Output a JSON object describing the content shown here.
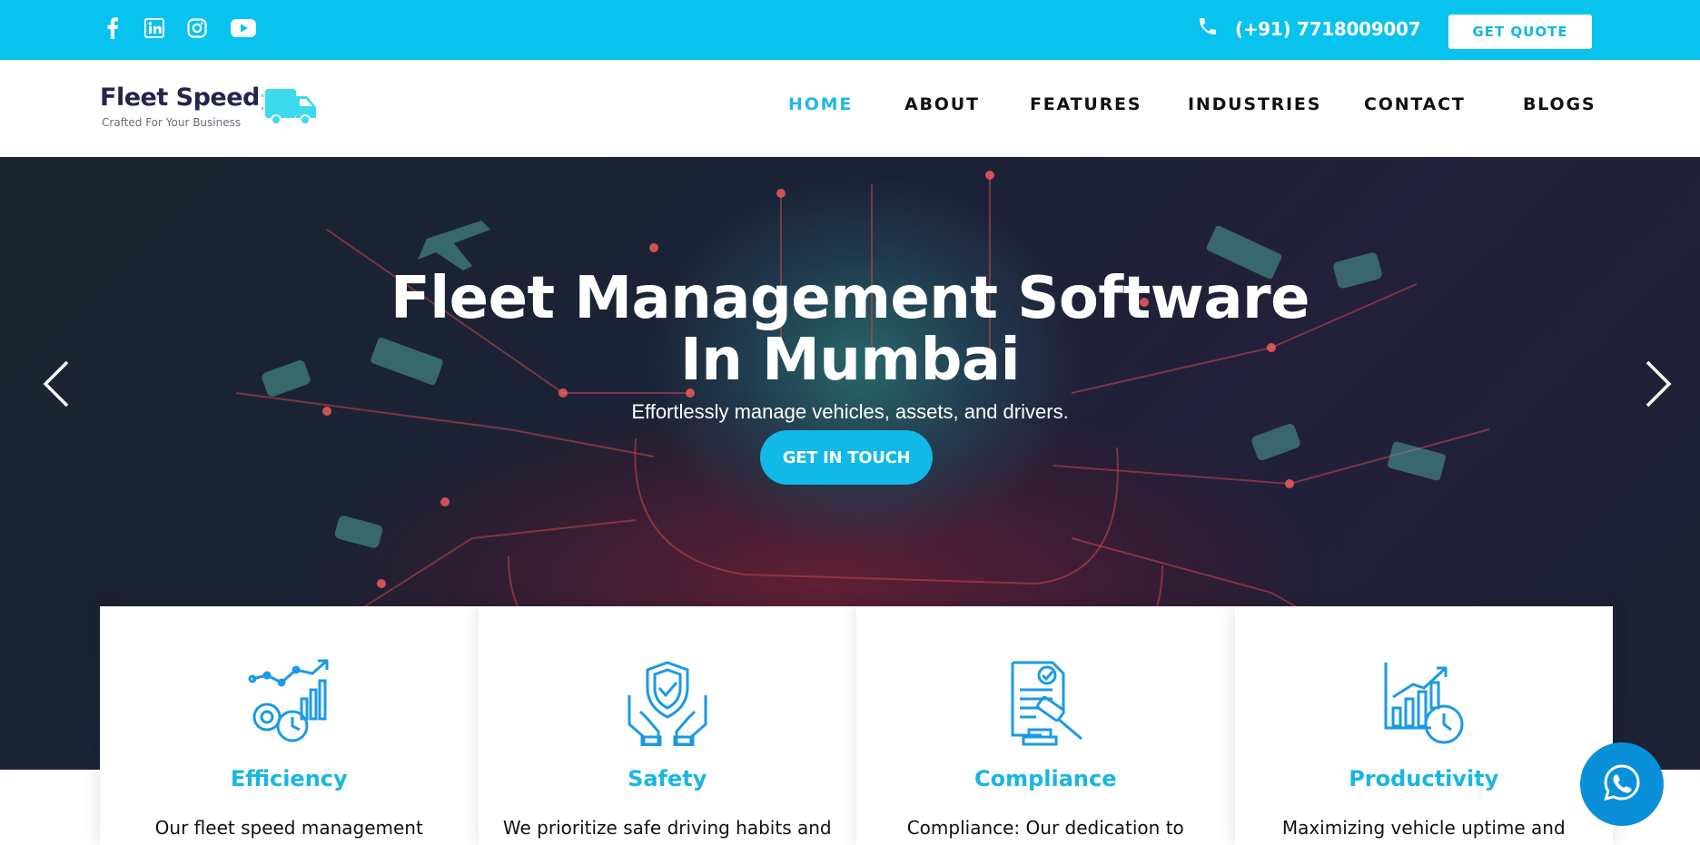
{
  "topbar": {
    "social": [
      {
        "name": "facebook-icon"
      },
      {
        "name": "linkedin-icon"
      },
      {
        "name": "instagram-icon"
      },
      {
        "name": "youtube-icon"
      }
    ],
    "phone": "(+91) 7718009007",
    "quote_label": "GET QUOTE"
  },
  "header": {
    "logo_title": "Fleet Speed",
    "logo_tagline": "Crafted For Your Business",
    "nav": [
      "HOME",
      "ABOUT",
      "FEATURES",
      "INDUSTRIES",
      "CONTACT",
      "BLOGS"
    ],
    "active_nav": "HOME"
  },
  "hero": {
    "title_line1": "Fleet Management Software",
    "title_line2": "In Mumbai",
    "subtitle": "Effortlessly manage vehicles, assets, and drivers.",
    "cta_label": "GET IN TOUCH"
  },
  "features": [
    {
      "title": "Efficiency",
      "text": "Our fleet speed management",
      "icon": "efficiency-icon"
    },
    {
      "title": "Safety",
      "text": "We prioritize safe driving habits and",
      "icon": "safety-icon"
    },
    {
      "title": "Compliance",
      "text": "Compliance: Our dedication to",
      "icon": "compliance-icon"
    },
    {
      "title": "Productivity",
      "text": "Maximizing vehicle uptime and",
      "icon": "productivity-icon"
    }
  ],
  "colors": {
    "accent": "#08c3ee",
    "nav_active": "#22b7e5",
    "dark_text": "#111111",
    "whatsapp": "#0a8fd9"
  }
}
